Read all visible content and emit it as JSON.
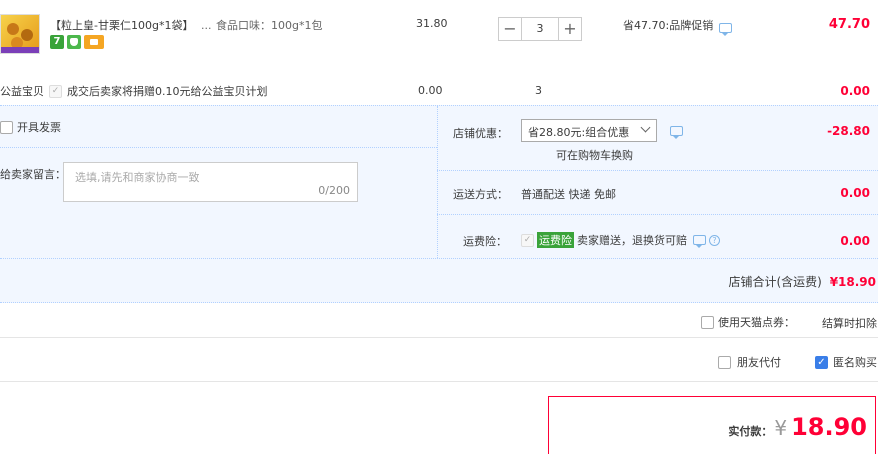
{
  "item": {
    "title": "【粒上皇-甘栗仁100g*1袋】",
    "ellipsis": "...",
    "sku": "食品口味：100g*1包",
    "price": "31.80",
    "quantity": "3",
    "promo": "省47.70:品牌促销",
    "subtotal": "47.70",
    "badge_seven": "7"
  },
  "charity": {
    "label": "公益宝贝",
    "text": "成交后卖家将捐赠0.10元给公益宝贝计划",
    "price": "0.00",
    "qty": "3",
    "total": "0.00"
  },
  "invoice": {
    "label": "开具发票"
  },
  "message": {
    "label": "给卖家留言：",
    "placeholder": "选填,请先和商家协商一致",
    "counter": "0/200"
  },
  "shop_discount": {
    "label": "店铺优惠：",
    "selected": "省28.80元:组合优惠",
    "note": "可在购物车换购",
    "value": "-28.80"
  },
  "shipping": {
    "label": "运送方式：",
    "text": "普通配送 快递 免邮",
    "value": "0.00"
  },
  "insurance": {
    "label": "运费险：",
    "tag": "运费险",
    "text": "卖家赠送，退换货可赔",
    "value": "0.00"
  },
  "shop_total": {
    "label": "店铺合计(含运费)",
    "value": "¥18.90"
  },
  "tmall_points": {
    "label": "使用天猫点券：",
    "note": "结算时扣除"
  },
  "options": {
    "friend_pay": "朋友代付",
    "anonymous": "匿名购买"
  },
  "payment": {
    "label": "实付款：",
    "currency": "¥",
    "amount": "18.90"
  },
  "colors": {
    "accent_red": "#ff0036",
    "panel_blue": "#f2f7ff",
    "border_blue": "#b2d1ff"
  }
}
